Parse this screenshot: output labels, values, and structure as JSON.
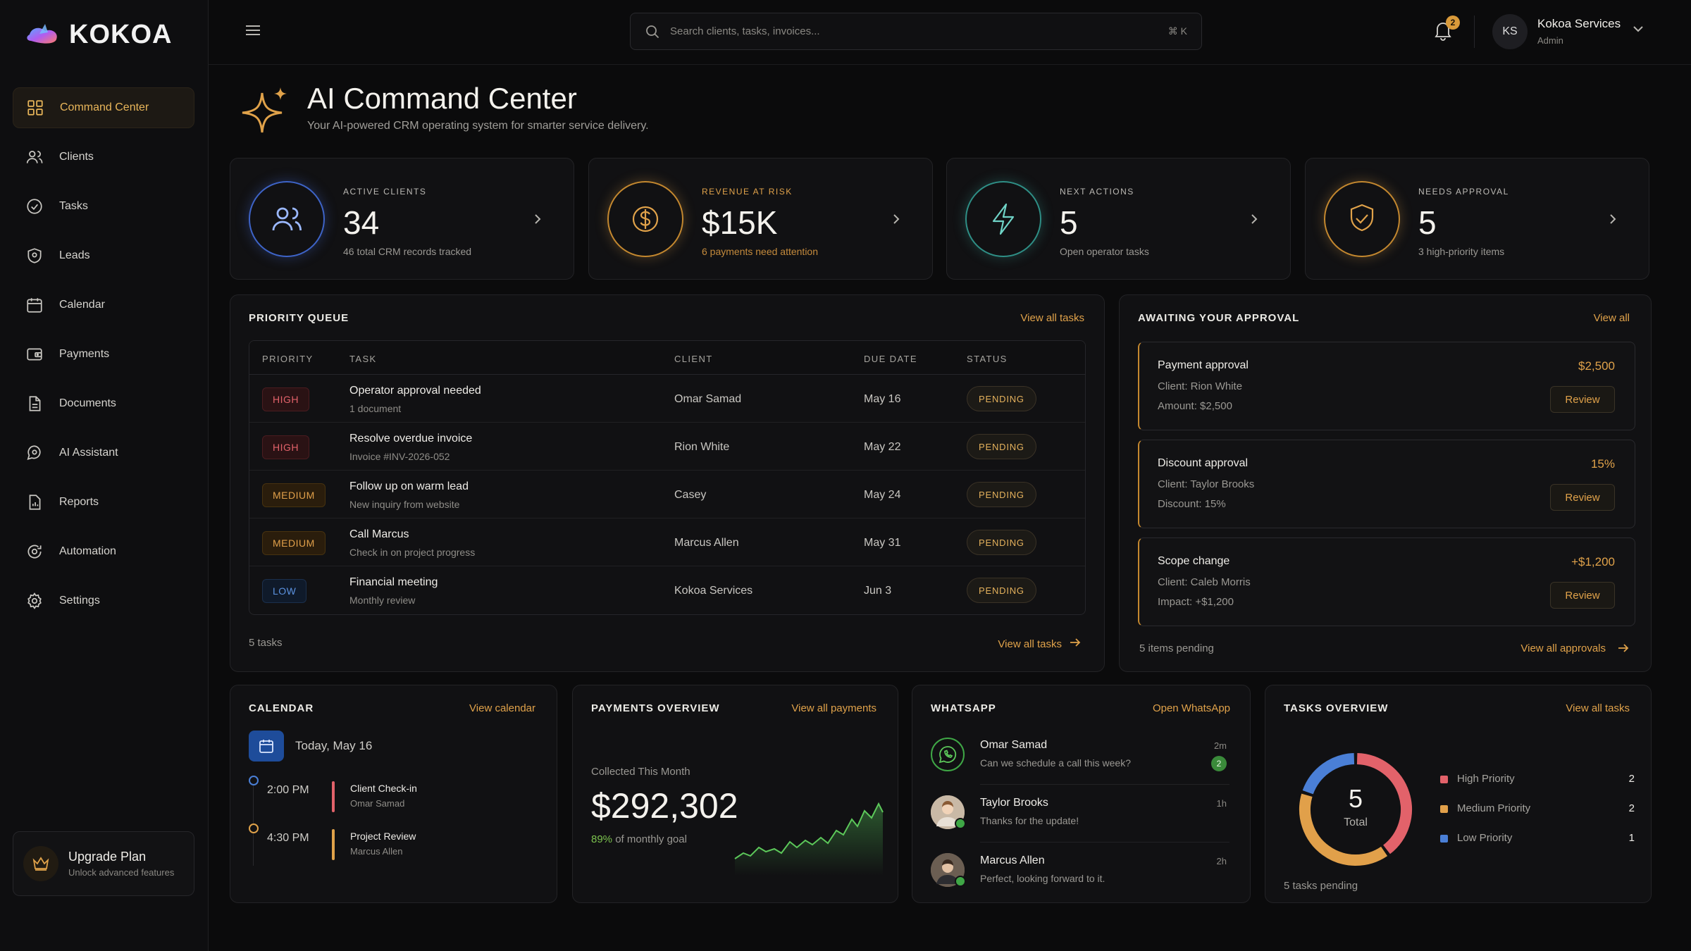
{
  "app": {
    "brand": "KOKOA",
    "colors": {
      "accent": "#E0A24A",
      "high": "#E2626A",
      "medium": "#E1A04A",
      "low": "#5C92E0",
      "whatsapp": "#3FA746"
    }
  },
  "sidebar": {
    "items": [
      {
        "label": "Command Center",
        "icon": "grid-icon"
      },
      {
        "label": "Clients",
        "icon": "users-icon"
      },
      {
        "label": "Tasks",
        "icon": "check-circle-icon"
      },
      {
        "label": "Leads",
        "icon": "shield-icon"
      },
      {
        "label": "Calendar",
        "icon": "calendar-icon"
      },
      {
        "label": "Payments",
        "icon": "wallet-icon"
      },
      {
        "label": "Documents",
        "icon": "document-icon"
      },
      {
        "label": "AI Assistant",
        "icon": "chat-bubble-icon"
      },
      {
        "label": "Reports",
        "icon": "report-icon"
      },
      {
        "label": "Automation",
        "icon": "automation-icon"
      },
      {
        "label": "Settings",
        "icon": "gear-icon"
      }
    ],
    "upgrade": {
      "title": "Upgrade Plan",
      "subtitle": "Unlock advanced features"
    }
  },
  "topbar": {
    "search_placeholder": "Search clients, tasks, invoices...",
    "shortcut": "⌘ K",
    "notification_count": "2",
    "user": {
      "initials": "KS",
      "name": "Kokoa Services",
      "role": "Admin"
    }
  },
  "header": {
    "title": "AI Command Center",
    "subtitle": "Your AI-powered CRM operating system for smarter service delivery."
  },
  "stats": [
    {
      "label": "ACTIVE CLIENTS",
      "value": "34",
      "sub": "46 total CRM records tracked"
    },
    {
      "label": "REVENUE AT RISK",
      "value": "$15K",
      "sub": "6 payments need attention"
    },
    {
      "label": "NEXT ACTIONS",
      "value": "5",
      "sub": "Open operator tasks"
    },
    {
      "label": "NEEDS APPROVAL",
      "value": "5",
      "sub": "3 high-priority items"
    }
  ],
  "priority_queue": {
    "title": "PRIORITY QUEUE",
    "link": "View all tasks",
    "columns": {
      "priority": "PRIORITY",
      "task": "TASK",
      "client": "CLIENT",
      "due": "DUE DATE",
      "status": "STATUS"
    },
    "rows": [
      {
        "priority": "HIGH",
        "title": "Operator approval needed",
        "sub": "1 document",
        "client": "Omar Samad",
        "due": "May 16",
        "status": "PENDING"
      },
      {
        "priority": "HIGH",
        "title": "Resolve overdue invoice",
        "sub": "Invoice #INV-2026-052",
        "client": "Rion White",
        "due": "May 22",
        "status": "PENDING"
      },
      {
        "priority": "MEDIUM",
        "title": "Follow up on warm lead",
        "sub": "New inquiry from website",
        "client": "Casey",
        "due": "May 24",
        "status": "PENDING"
      },
      {
        "priority": "MEDIUM",
        "title": "Call Marcus",
        "sub": "Check in on project progress",
        "client": "Marcus Allen",
        "due": "May 31",
        "status": "PENDING"
      },
      {
        "priority": "LOW",
        "title": "Financial meeting",
        "sub": "Monthly review",
        "client": "Kokoa Services",
        "due": "Jun 3",
        "status": "PENDING"
      }
    ],
    "count": "5 tasks",
    "footer_link": "View all tasks"
  },
  "approvals": {
    "title": "AWAITING YOUR APPROVAL",
    "link": "View all",
    "items": [
      {
        "title": "Payment approval",
        "line1": "Client: Rion White",
        "line2": "Amount: $2,500",
        "amount": "$2,500",
        "action": "Review"
      },
      {
        "title": "Discount approval",
        "line1": "Client: Taylor Brooks",
        "line2": "Discount: 15%",
        "amount": "15%",
        "action": "Review"
      },
      {
        "title": "Scope change",
        "line1": "Client: Caleb Morris",
        "line2": "Impact: +$1,200",
        "amount": "+$1,200",
        "action": "Review"
      }
    ],
    "count": "5 items pending",
    "footer_link": "View all approvals"
  },
  "calendar": {
    "title": "CALENDAR",
    "link": "View calendar",
    "today": "Today, May 16",
    "events": [
      {
        "time": "2:00 PM",
        "title": "Client Check-in",
        "person": "Omar Samad"
      },
      {
        "time": "4:30 PM",
        "title": "Project Review",
        "person": "Marcus Allen"
      }
    ]
  },
  "payments": {
    "title": "PAYMENTS OVERVIEW",
    "link": "View all payments",
    "label": "Collected This Month",
    "value": "$292,302",
    "goal_pct": "89%",
    "goal_text": "of monthly goal"
  },
  "whatsapp": {
    "title": "WHATSAPP",
    "link": "Open WhatsApp",
    "messages": [
      {
        "name": "Omar Samad",
        "text": "Can we schedule a call this week?",
        "time": "2m",
        "unread": "2"
      },
      {
        "name": "Taylor Brooks",
        "text": "Thanks for the update!",
        "time": "1h"
      },
      {
        "name": "Marcus Allen",
        "text": "Perfect, looking forward to it.",
        "time": "2h"
      }
    ]
  },
  "tasks_overview": {
    "title": "TASKS OVERVIEW",
    "link": "View all tasks",
    "total": "5",
    "total_label": "Total",
    "legend": [
      {
        "name": "High Priority",
        "value": "2",
        "color": "#E2626A"
      },
      {
        "name": "Medium Priority",
        "value": "2",
        "color": "#E1A04A"
      },
      {
        "name": "Low Priority",
        "value": "1",
        "color": "#4A7FD6"
      }
    ],
    "pending": "5 tasks pending"
  }
}
